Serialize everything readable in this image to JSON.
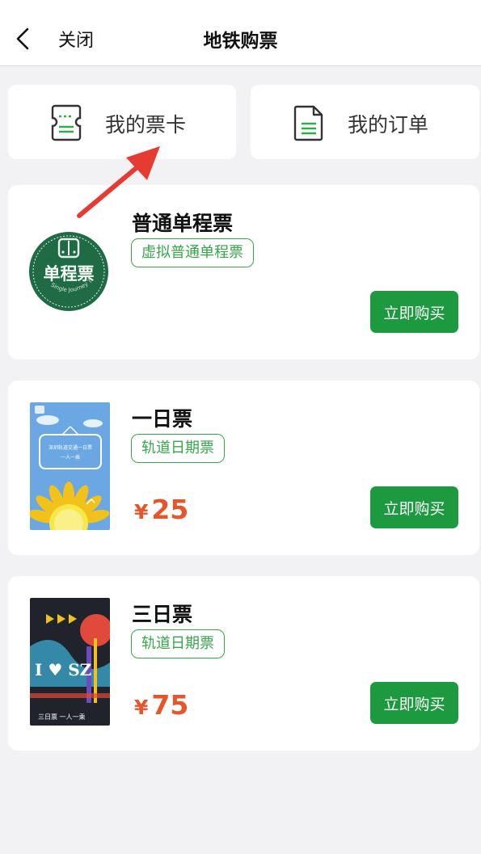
{
  "navbar": {
    "close_label": "关闭",
    "title": "地铁购票",
    "back_icon": "chevron-left-icon"
  },
  "quick_actions": [
    {
      "label": "我的票卡",
      "icon": "ticket-card-icon"
    },
    {
      "label": "我的订单",
      "icon": "order-document-icon"
    }
  ],
  "tickets": [
    {
      "name": "普通单程票",
      "tag": "虚拟普通单程票",
      "button": "立即购买",
      "image_text": "单程票",
      "image_subtext": "Single Journey Ticket"
    },
    {
      "name": "一日票",
      "tag": "轨道日期票",
      "price_symbol": "¥",
      "price": "25",
      "button": "立即购买",
      "image_text": "深圳轨道交通一日票",
      "image_subtext": "一人一乘"
    },
    {
      "name": "三日票",
      "tag": "轨道日期票",
      "price_symbol": "¥",
      "price": "75",
      "button": "立即购买",
      "image_text": "I ♥ SZ",
      "image_subtext": "三日票 一人一乘"
    }
  ],
  "colors": {
    "accent_green": "#1d9a3f",
    "tag_green": "#37a64a",
    "price_red": "#e5562b",
    "background": "#f2f2f4"
  }
}
